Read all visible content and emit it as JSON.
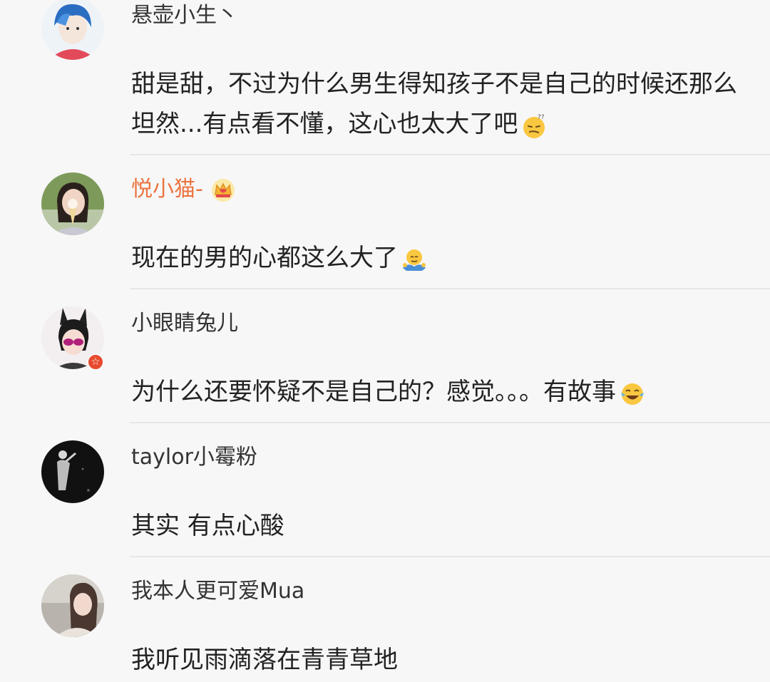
{
  "comments": [
    {
      "username": "悬壶小生丶",
      "content": "甜是甜，不过为什么男生得知孩子不是自己的时候还那么坦然...有点看不懂，这心也太大了吧",
      "emoji": "dizzy-thinking-emoji-icon"
    },
    {
      "username": "悦小猫-",
      "content": "现在的男的心都这么大了",
      "emoji": "shrug-emoji-icon",
      "badge": "crown-icon",
      "vip_color": "#eb7340"
    },
    {
      "username": "小眼睛兔儿",
      "content": "为什么还要怀疑不是自己的？感觉。。。有故事",
      "emoji": "laughing-tears-emoji-icon",
      "verified": "verified-badge-icon"
    },
    {
      "username": "taylor小霉粉",
      "content": "其实 有点心酸"
    },
    {
      "username": "我本人更可爱Mua",
      "content": "我听见雨滴落在青青草地"
    }
  ],
  "colors": {
    "background": "#f7f7f7",
    "divider": "#e6e6e6",
    "vip_name": "#eb7340",
    "verified_badge": "#e84a2f"
  }
}
